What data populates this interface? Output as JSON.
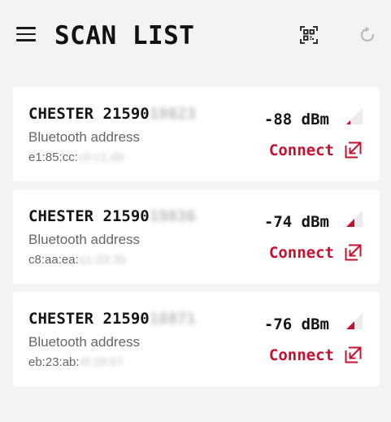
{
  "header": {
    "title": "SCAN LIST",
    "menu_icon": "menu-icon",
    "qr_icon": "qr-code-scan-icon",
    "refresh_icon": "refresh-icon"
  },
  "colors": {
    "accent": "#c8102e",
    "background": "#f3f3f3",
    "card": "#ffffff",
    "disabled_icon": "#bdbdbd"
  },
  "devices": [
    {
      "name_prefix": "CHESTER 21590",
      "name_obscured": "19823",
      "address_label": "Bluetooth address",
      "address_prefix": "e1:85:cc:",
      "address_obscured": "c0:c1:d9",
      "rssi": "-88 dBm",
      "signal_fraction": 0.25,
      "connect_label": "Connect"
    },
    {
      "name_prefix": "CHESTER 21590",
      "name_obscured": "19836",
      "address_label": "Bluetooth address",
      "address_prefix": "c8:aa:ea:",
      "address_obscured": "a1:d3:3b",
      "rssi": "-74 dBm",
      "signal_fraction": 0.5,
      "connect_label": "Connect"
    },
    {
      "name_prefix": "CHESTER 21590",
      "name_obscured": "18871",
      "address_label": "Bluetooth address",
      "address_prefix": "eb:23:ab:",
      "address_obscured": "4f:28:97",
      "rssi": "-76 dBm",
      "signal_fraction": 0.5,
      "connect_label": "Connect"
    }
  ]
}
